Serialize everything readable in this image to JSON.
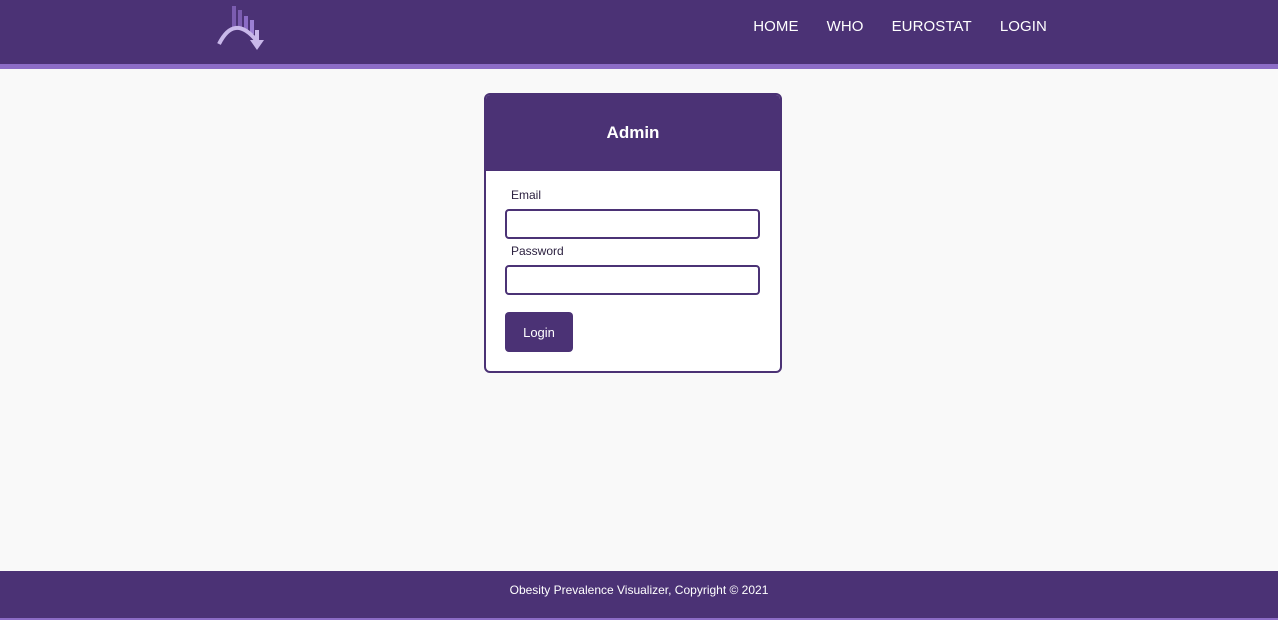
{
  "header": {
    "logo_icon": "chart-down-arrow-icon",
    "nav": [
      "HOME",
      "WHO",
      "EUROSTAT",
      "LOGIN"
    ]
  },
  "login_card": {
    "title": "Admin",
    "email_label": "Email",
    "email_value": "",
    "password_label": "Password",
    "password_value": "",
    "submit_label": "Login"
  },
  "footer": {
    "text": "Obesity Prevalence Visualizer, Copyright © 2021"
  },
  "colors": {
    "primary": "#4b3275",
    "accent": "#8c6cc6",
    "background": "#f9f9f9"
  }
}
